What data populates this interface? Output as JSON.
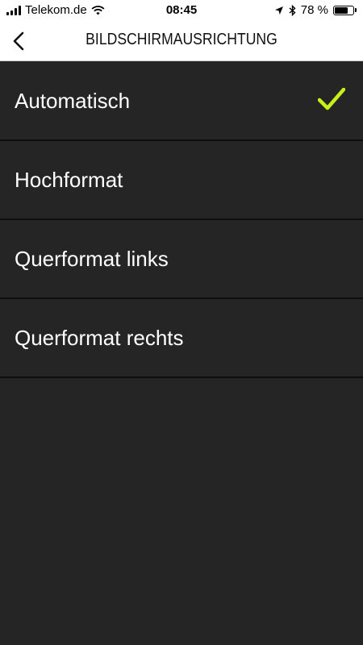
{
  "status_bar": {
    "carrier": "Telekom.de",
    "time": "08:45",
    "battery_percent": "78 %",
    "battery_level": 0.78
  },
  "nav": {
    "title": "BILDSCHIRMAUSRICHTUNG",
    "back_icon": "chevron-left-icon"
  },
  "options": [
    {
      "label": "Automatisch",
      "selected": true
    },
    {
      "label": "Hochformat",
      "selected": false
    },
    {
      "label": "Querformat links",
      "selected": false
    },
    {
      "label": "Querformat rechts",
      "selected": false
    }
  ],
  "colors": {
    "background": "#252525",
    "accent_check": "#c8f01a",
    "text": "#ffffff",
    "separator": "#0e0e0e"
  }
}
